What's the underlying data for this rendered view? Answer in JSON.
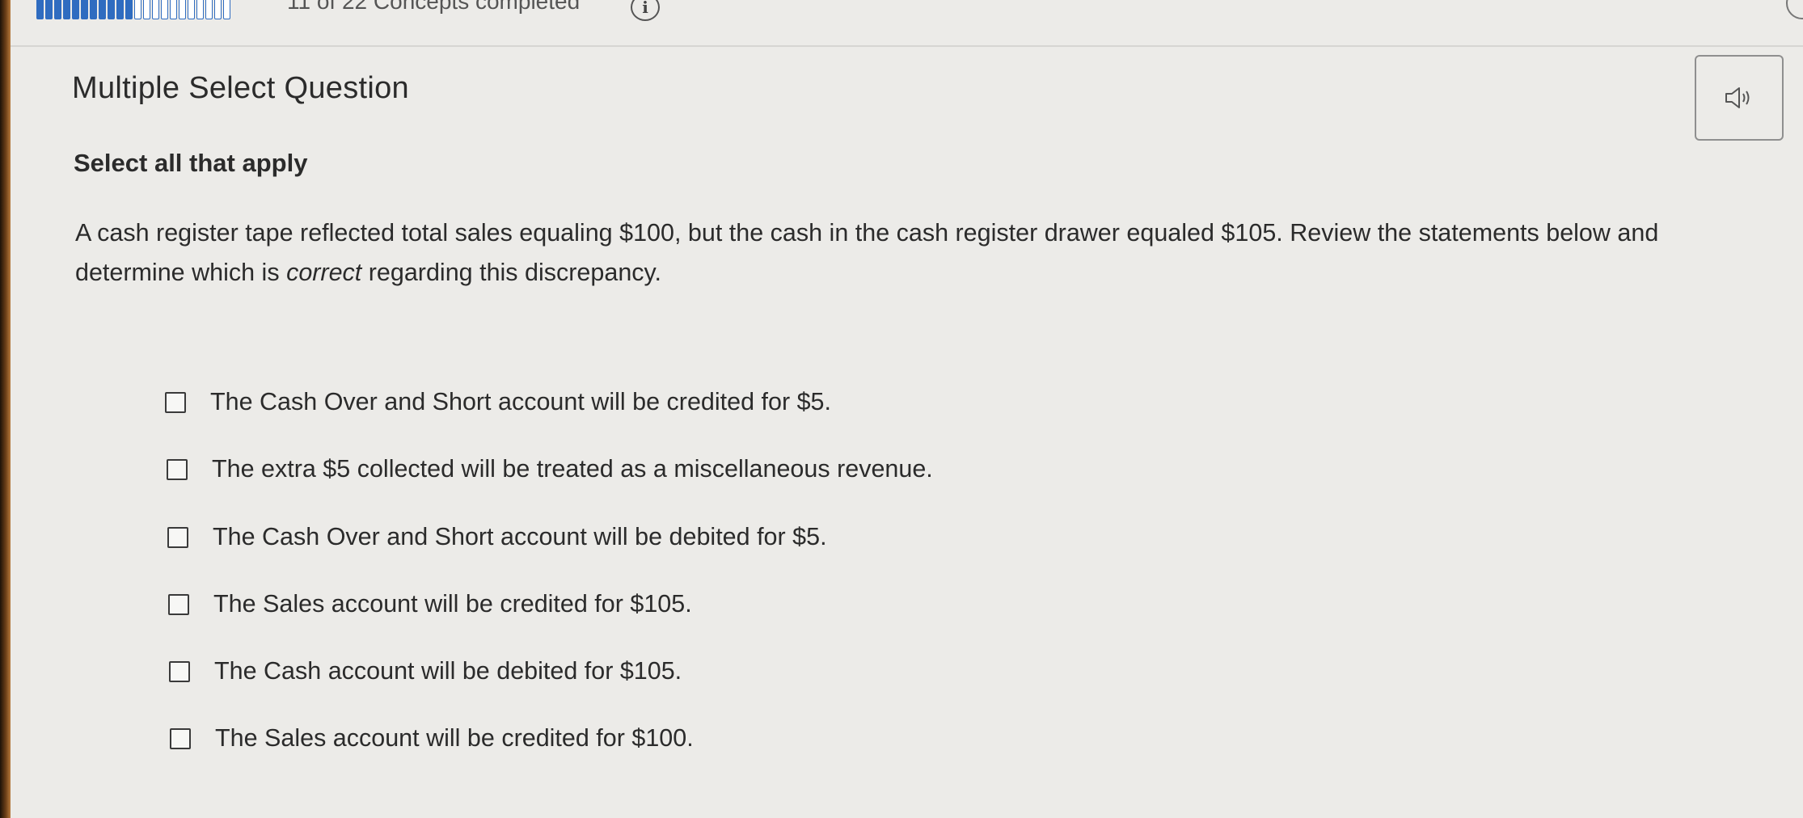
{
  "progress": {
    "completed_segments": 11,
    "total_segments": 22,
    "label": "11 of 22 Concepts completed",
    "info_icon": "info-icon"
  },
  "question": {
    "heading": "Multiple Select Question",
    "audio_icon": "speaker-icon",
    "instruction": "Select all that apply",
    "prompt_before": "A cash register tape reflected total sales equaling $100, but the cash in the cash register drawer equaled $105. Review the statements below and determine which is ",
    "prompt_emphasis": "correct",
    "prompt_after": " regarding this discrepancy."
  },
  "options": [
    {
      "label": "The Cash Over and Short account will be credited for $5.",
      "checked": false
    },
    {
      "label": "The extra $5 collected will be treated as a miscellaneous revenue.",
      "checked": false
    },
    {
      "label": "The Cash Over and Short account will be debited for $5.",
      "checked": false
    },
    {
      "label": "The Sales account will be credited for $105.",
      "checked": false
    },
    {
      "label": "The Cash account will be debited for $105.",
      "checked": false
    },
    {
      "label": "The Sales account will be credited for $100.",
      "checked": false
    }
  ],
  "colors": {
    "background": "#ecebe8",
    "progress_fill": "#2f6cc0",
    "text": "#2b2b2b"
  }
}
